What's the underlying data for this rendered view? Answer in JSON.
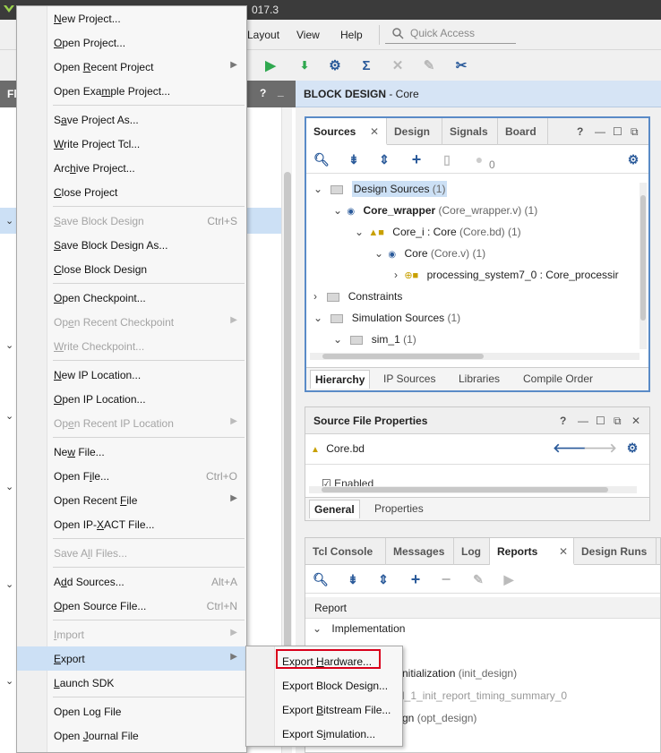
{
  "titlebar": {
    "version_text": "017.3"
  },
  "menubar": {
    "items": [
      "Layout",
      "View",
      "Help"
    ],
    "quick_access_placeholder": "Quick Access"
  },
  "left_panel": {
    "header_label": "Fl"
  },
  "block_design": {
    "header_bold": "BLOCK DESIGN",
    "header_rest": " - Core"
  },
  "sources": {
    "tabs": [
      "Sources",
      "Design",
      "Signals",
      "Board"
    ],
    "count": "0",
    "tree": [
      {
        "label": "Design Sources",
        "suffix": " (1)"
      },
      {
        "label": "Core_wrapper",
        "suffix": " (Core_wrapper.v) (1)"
      },
      {
        "label": "Core_i : Core",
        "suffix": " (Core.bd) (1)"
      },
      {
        "label": "Core",
        "suffix": " (Core.v) (1)"
      },
      {
        "label": "processing_system7_0 : Core_processir",
        "suffix": ""
      },
      {
        "label": "Constraints",
        "suffix": ""
      },
      {
        "label": "Simulation Sources",
        "suffix": " (1)"
      },
      {
        "label": "sim_1",
        "suffix": " (1)"
      }
    ],
    "bottom_tabs": [
      "Hierarchy",
      "IP Sources",
      "Libraries",
      "Compile Order"
    ]
  },
  "source_file_properties": {
    "title": "Source File Properties",
    "file": "Core.bd",
    "partial_row": "Enabled",
    "tabs": [
      "General",
      "Properties"
    ]
  },
  "tcl_panel": {
    "tabs": [
      "Tcl Console",
      "Messages",
      "Log",
      "Reports",
      "Design Runs"
    ],
    "column_header": "Report",
    "rows": [
      "Implementation",
      "nitialization",
      "(init_design)",
      "l_1_init_report_timing_summary_0",
      "gn",
      "(opt_design)"
    ]
  },
  "menu": {
    "items": [
      {
        "label": "New Project...",
        "u": "N",
        "shortcut": "",
        "submenu": false,
        "disabled": false
      },
      {
        "label": "Open Project...",
        "u": "O",
        "shortcut": "",
        "submenu": false,
        "disabled": false
      },
      {
        "label": "Open Recent Project",
        "u": "R",
        "shortcut": "",
        "submenu": true,
        "disabled": false
      },
      {
        "label": "Open Example Project...",
        "u": "m",
        "shortcut": "",
        "submenu": false,
        "disabled": false
      },
      {
        "label": "Save Project As...",
        "u": "a",
        "shortcut": "",
        "submenu": false,
        "disabled": false
      },
      {
        "label": "Write Project Tcl...",
        "u": "W",
        "shortcut": "",
        "submenu": false,
        "disabled": false
      },
      {
        "label": "Archive Project...",
        "u": "h",
        "shortcut": "",
        "submenu": false,
        "disabled": false
      },
      {
        "label": "Close Project",
        "u": "C",
        "shortcut": "",
        "submenu": false,
        "disabled": false
      },
      {
        "label": "Save Block Design",
        "u": "S",
        "shortcut": "Ctrl+S",
        "submenu": false,
        "disabled": true
      },
      {
        "label": "Save Block Design As...",
        "u": "S",
        "shortcut": "",
        "submenu": false,
        "disabled": false
      },
      {
        "label": "Close Block Design",
        "u": "C",
        "shortcut": "",
        "submenu": false,
        "disabled": false
      },
      {
        "label": "Open Checkpoint...",
        "u": "O",
        "shortcut": "",
        "submenu": false,
        "disabled": false
      },
      {
        "label": "Open Recent Checkpoint",
        "u": "e",
        "shortcut": "",
        "submenu": true,
        "disabled": true
      },
      {
        "label": "Write Checkpoint...",
        "u": "W",
        "shortcut": "",
        "submenu": false,
        "disabled": true
      },
      {
        "label": "New IP Location...",
        "u": "N",
        "shortcut": "",
        "submenu": false,
        "disabled": false
      },
      {
        "label": "Open IP Location...",
        "u": "O",
        "shortcut": "",
        "submenu": false,
        "disabled": false
      },
      {
        "label": "Open Recent IP Location",
        "u": "e",
        "shortcut": "",
        "submenu": true,
        "disabled": true
      },
      {
        "label": "New File...",
        "u": "w",
        "shortcut": "",
        "submenu": false,
        "disabled": false
      },
      {
        "label": "Open File...",
        "u": "i",
        "shortcut": "Ctrl+O",
        "submenu": false,
        "disabled": false
      },
      {
        "label": "Open Recent File",
        "u": "F",
        "shortcut": "",
        "submenu": true,
        "disabled": false
      },
      {
        "label": "Open IP-XACT File...",
        "u": "X",
        "shortcut": "",
        "submenu": false,
        "disabled": false
      },
      {
        "label": "Save All Files...",
        "u": "l",
        "shortcut": "",
        "submenu": false,
        "disabled": true
      },
      {
        "label": "Add Sources...",
        "u": "d",
        "shortcut": "Alt+A",
        "submenu": false,
        "disabled": false
      },
      {
        "label": "Open Source File...",
        "u": "O",
        "shortcut": "Ctrl+N",
        "submenu": false,
        "disabled": false
      },
      {
        "label": "Import",
        "u": "I",
        "shortcut": "",
        "submenu": true,
        "disabled": true
      },
      {
        "label": "Export",
        "u": "E",
        "shortcut": "",
        "submenu": true,
        "disabled": false,
        "highlighted": true
      },
      {
        "label": "Launch SDK",
        "u": "L",
        "shortcut": "",
        "submenu": false,
        "disabled": false
      },
      {
        "label": "Open Log File",
        "u": "g",
        "shortcut": "",
        "submenu": false,
        "disabled": false
      },
      {
        "label": "Open Journal File",
        "u": "J",
        "shortcut": "",
        "submenu": false,
        "disabled": false
      }
    ]
  },
  "submenu": {
    "items": [
      {
        "label": "Export Hardware...",
        "u": "H"
      },
      {
        "label": "Export Block Design...",
        "u": ""
      },
      {
        "label": "Export Bitstream File...",
        "u": "B"
      },
      {
        "label": "Export Simulation...",
        "u": "i"
      }
    ]
  },
  "colors": {
    "highlight": "#cce0f5",
    "red_box": "#d9001b",
    "focus_border": "#5a8bc7"
  }
}
